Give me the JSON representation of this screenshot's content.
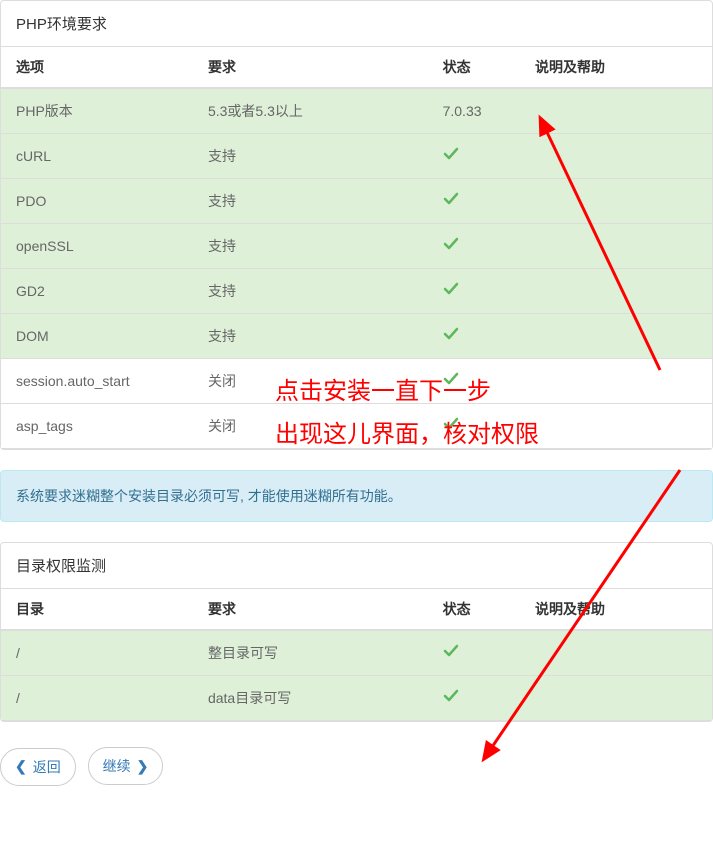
{
  "php_env": {
    "title": "PHP环境要求",
    "headers": {
      "option": "选项",
      "require": "要求",
      "status": "状态",
      "help": "说明及帮助"
    },
    "rows": [
      {
        "option": "PHP版本",
        "require": "5.3或者5.3以上",
        "status_text": "7.0.33",
        "status_icon": "",
        "row_class": "success"
      },
      {
        "option": "cURL",
        "require": "支持",
        "status_text": "",
        "status_icon": "check",
        "row_class": "success"
      },
      {
        "option": "PDO",
        "require": "支持",
        "status_text": "",
        "status_icon": "check",
        "row_class": "success"
      },
      {
        "option": "openSSL",
        "require": "支持",
        "status_text": "",
        "status_icon": "check",
        "row_class": "success"
      },
      {
        "option": "GD2",
        "require": "支持",
        "status_text": "",
        "status_icon": "check",
        "row_class": "success"
      },
      {
        "option": "DOM",
        "require": "支持",
        "status_text": "",
        "status_icon": "check",
        "row_class": "success"
      },
      {
        "option": "session.auto_start",
        "require": "关闭",
        "status_text": "",
        "status_icon": "check",
        "row_class": "plain"
      },
      {
        "option": "asp_tags",
        "require": "关闭",
        "status_text": "",
        "status_icon": "check",
        "row_class": "plain"
      }
    ]
  },
  "alert": {
    "text": "系统要求迷糊整个安装目录必须可写, 才能使用迷糊所有功能。"
  },
  "dir_perm": {
    "title": "目录权限监测",
    "headers": {
      "dir": "目录",
      "require": "要求",
      "status": "状态",
      "help": "说明及帮助"
    },
    "rows": [
      {
        "dir": "/",
        "require": "整目录可写",
        "status_icon": "check",
        "row_class": "success"
      },
      {
        "dir": "/",
        "require": "data目录可写",
        "status_icon": "check",
        "row_class": "success"
      }
    ]
  },
  "buttons": {
    "back": "返回",
    "continue": "继续"
  },
  "annotation": {
    "line1": "点击安装一直下一步",
    "line2": "出现这儿界面，核对权限"
  }
}
